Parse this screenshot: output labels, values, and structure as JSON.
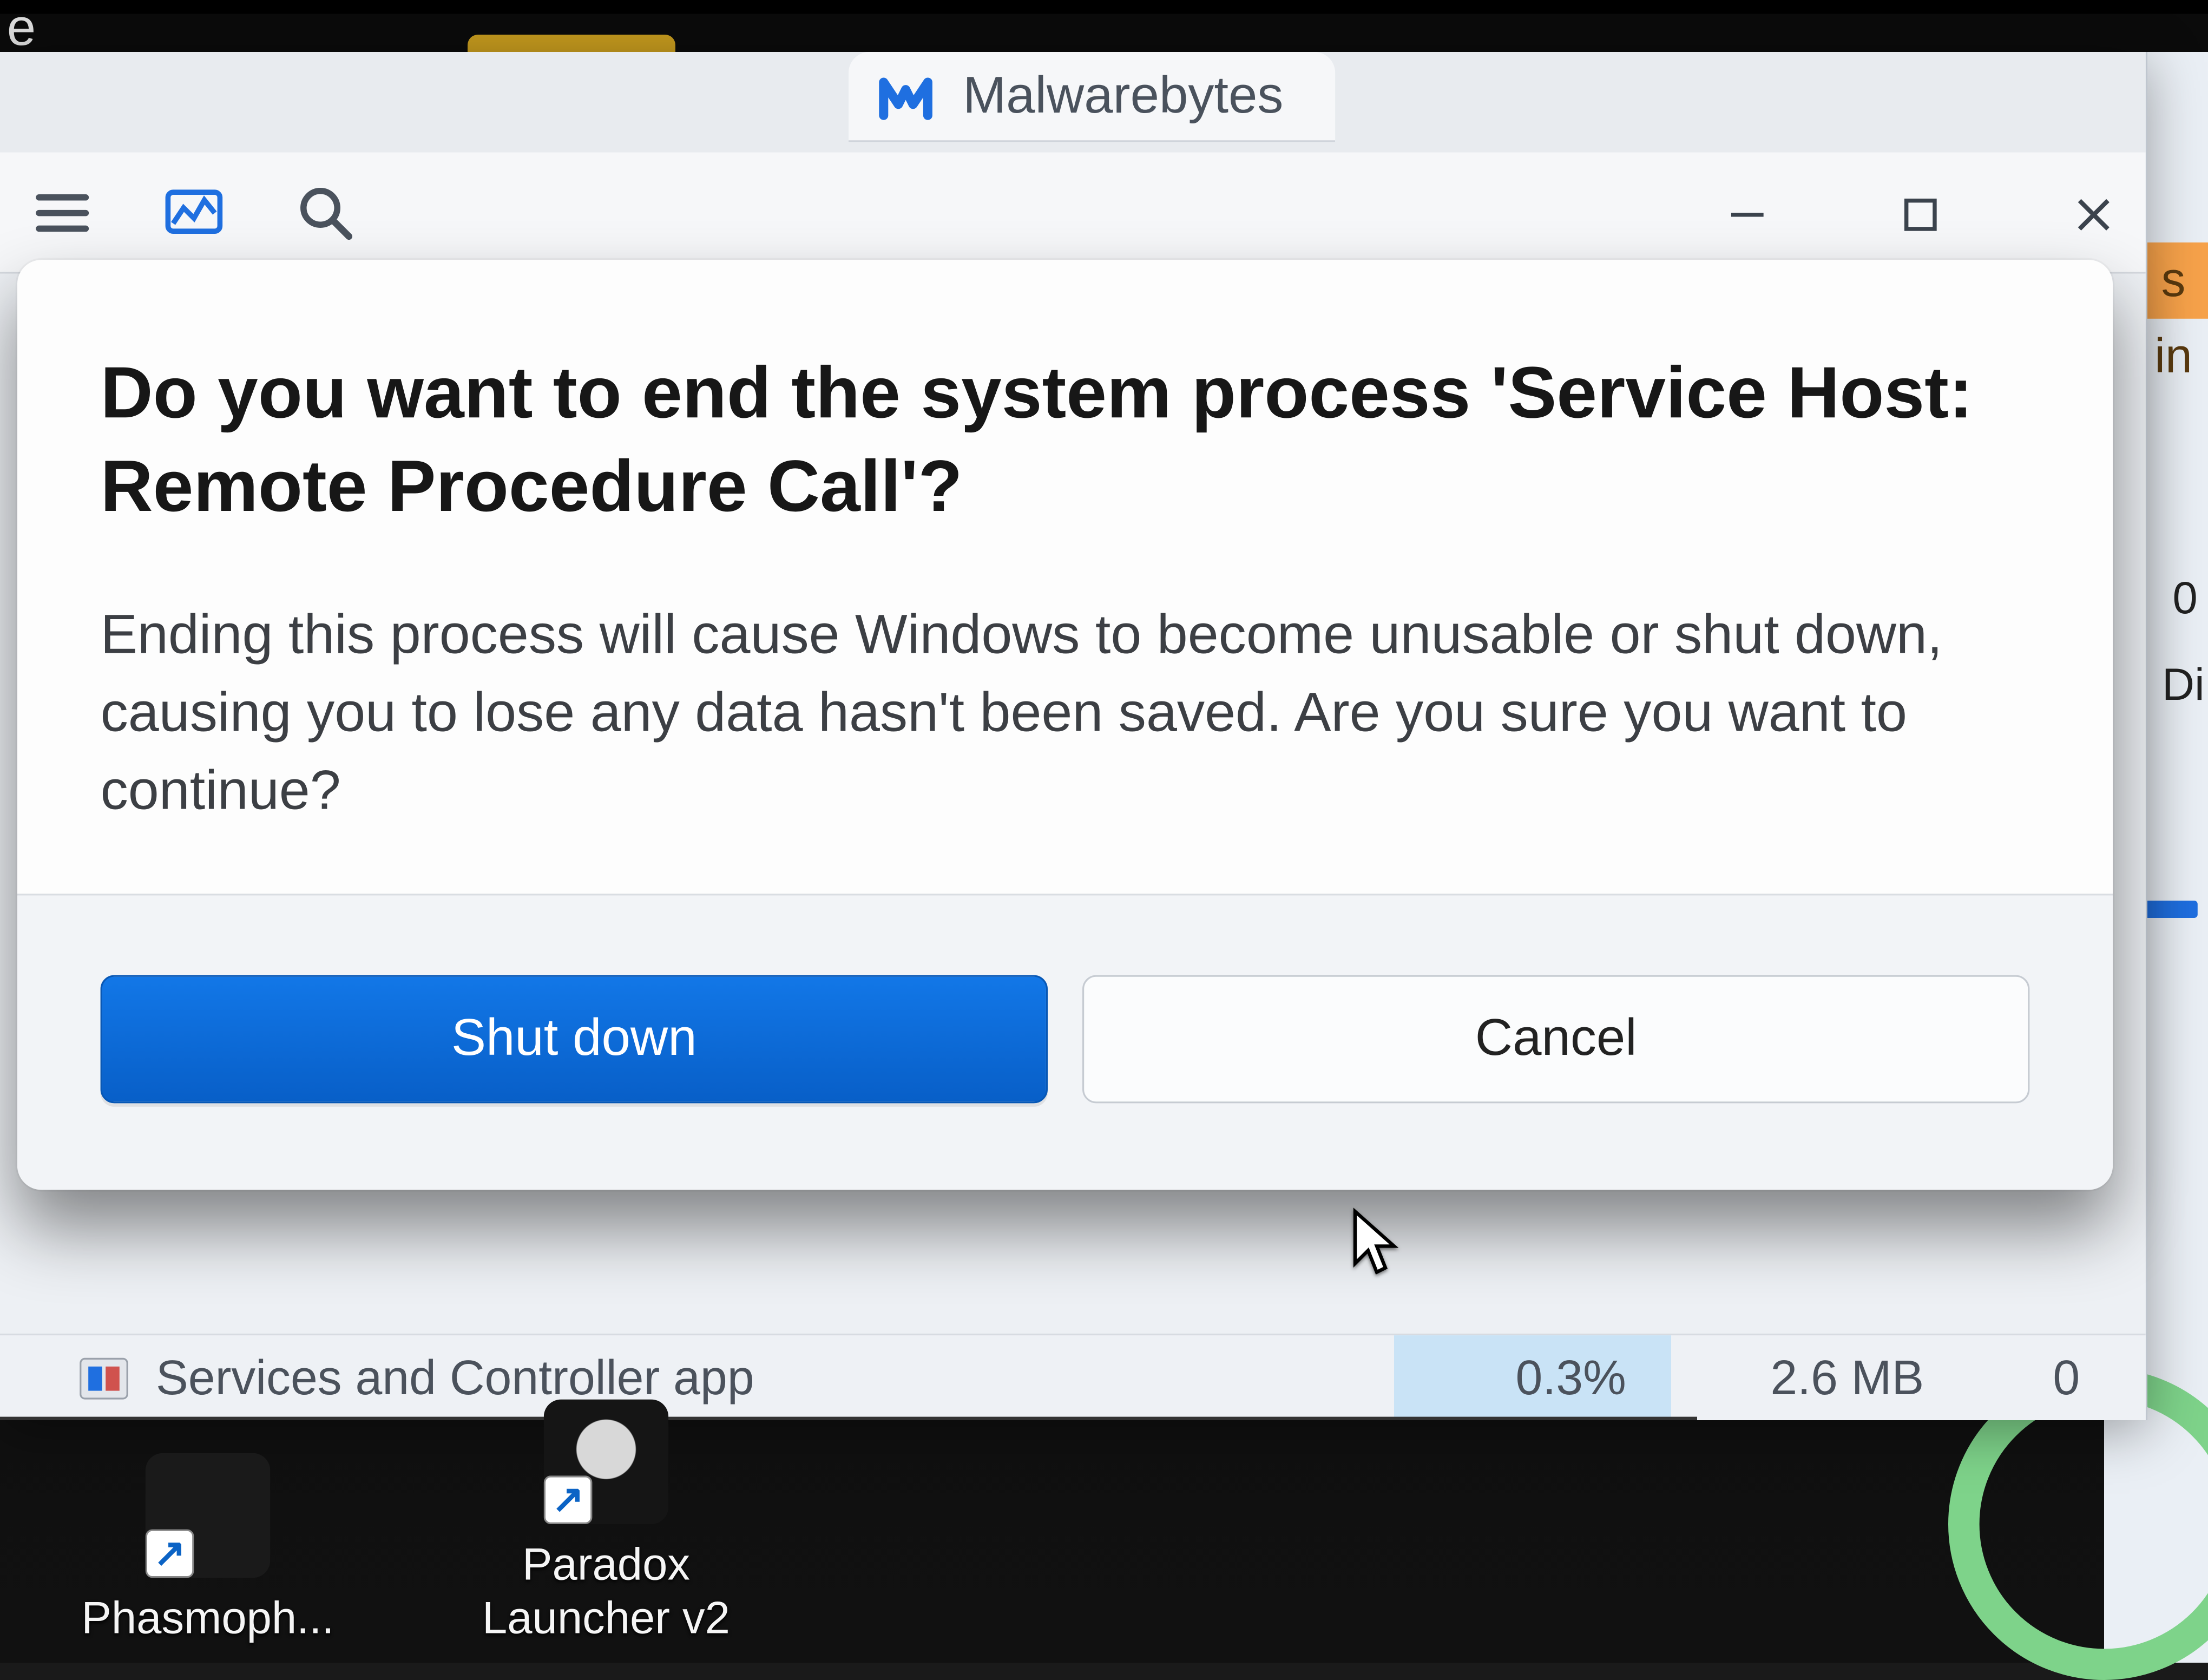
{
  "backgroundTab": {
    "title": "Malwarebytes",
    "logo_name": "malwarebytes-logo"
  },
  "toolbar": {
    "hamburger_name": "menu-icon",
    "chart_name": "performance-chart-icon",
    "search_name": "search-icon"
  },
  "windowControls": {
    "minimize_name": "minimize-icon",
    "maximize_name": "maximize-icon",
    "close_name": "close-icon"
  },
  "rightPanel": {
    "orange_text": "s in",
    "floating_text_1": "0",
    "floating_text_2": "Di"
  },
  "corner_text": "e",
  "processRow": {
    "name": "Services and Controller app",
    "cpu": "0.3%",
    "memory": "2.6 MB",
    "disk": "0"
  },
  "dialog": {
    "title": "Do you want to end the system process 'Service Host: Remote Procedure Call'?",
    "message": "Ending this process will cause Windows to become unusable or shut down, causing you to lose any data hasn't been saved. Are you sure you want to continue?",
    "primary_label": "Shut down",
    "secondary_label": "Cancel"
  },
  "desktopIcons": [
    {
      "label": "Phasmoph..."
    },
    {
      "label": "Paradox\nLauncher v2"
    }
  ],
  "colors": {
    "accent": "#0a6cde"
  }
}
